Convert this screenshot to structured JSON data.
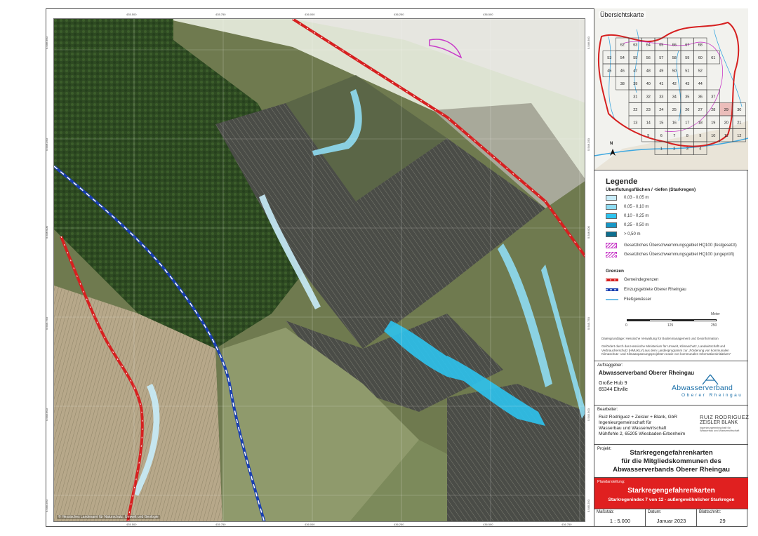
{
  "map": {
    "attribution": "© Hessisches Landesamt für Naturschutz, Umwelt und Geologie",
    "x_ticks": [
      "435.500",
      "435.750",
      "436.000",
      "436.250",
      "436.500",
      "436.750"
    ],
    "y_ticks": [
      "5.546.500",
      "5.546.250",
      "5.546.000",
      "5.545.750",
      "5.545.500",
      "5.545.250"
    ],
    "y_ticks_right": [
      "5.546.500",
      "5.546.250",
      "5.546.000",
      "5.545.750",
      "5.545.500",
      "5.545.250"
    ]
  },
  "overview": {
    "title": "Übersichtskarte",
    "north": "N",
    "tiles": [
      {
        "n": "62"
      },
      {
        "n": "63"
      },
      {
        "n": "64"
      },
      {
        "n": "65"
      },
      {
        "n": "66"
      },
      {
        "n": "67"
      },
      {
        "n": "68"
      },
      {
        "n": "53"
      },
      {
        "n": "54"
      },
      {
        "n": "55"
      },
      {
        "n": "56"
      },
      {
        "n": "57"
      },
      {
        "n": "58"
      },
      {
        "n": "59"
      },
      {
        "n": "60"
      },
      {
        "n": "61"
      },
      {
        "n": "45"
      },
      {
        "n": "46"
      },
      {
        "n": "47"
      },
      {
        "n": "48"
      },
      {
        "n": "49"
      },
      {
        "n": "50"
      },
      {
        "n": "51"
      },
      {
        "n": "52"
      },
      {
        "n": "38"
      },
      {
        "n": "39"
      },
      {
        "n": "40"
      },
      {
        "n": "41"
      },
      {
        "n": "42"
      },
      {
        "n": "43"
      },
      {
        "n": "44"
      },
      {
        "n": "31"
      },
      {
        "n": "32"
      },
      {
        "n": "33"
      },
      {
        "n": "34"
      },
      {
        "n": "35"
      },
      {
        "n": "36"
      },
      {
        "n": "37"
      },
      {
        "n": "22"
      },
      {
        "n": "23"
      },
      {
        "n": "24"
      },
      {
        "n": "25"
      },
      {
        "n": "26"
      },
      {
        "n": "27"
      },
      {
        "n": "28"
      },
      {
        "n": "29"
      },
      {
        "n": "30"
      },
      {
        "n": "13"
      },
      {
        "n": "14"
      },
      {
        "n": "15"
      },
      {
        "n": "16"
      },
      {
        "n": "17"
      },
      {
        "n": "18"
      },
      {
        "n": "19"
      },
      {
        "n": "20"
      },
      {
        "n": "21"
      },
      {
        "n": "5"
      },
      {
        "n": "6"
      },
      {
        "n": "7"
      },
      {
        "n": "8"
      },
      {
        "n": "9"
      },
      {
        "n": "10"
      },
      {
        "n": "11"
      },
      {
        "n": "12"
      },
      {
        "n": "1"
      },
      {
        "n": "2"
      },
      {
        "n": "3"
      },
      {
        "n": "4"
      }
    ]
  },
  "legend": {
    "title": "Legende",
    "flood_title": "Überflutungsflächen / -tiefen (Starkregen)",
    "flood_classes": [
      {
        "label": "0,03 - 0,05 m",
        "color": "#c8ecf9"
      },
      {
        "label": "0,05 - 0,10 m",
        "color": "#8fdcf2"
      },
      {
        "label": "0,10 - 0,25 m",
        "color": "#2ec3ee"
      },
      {
        "label": "0,25 - 0,50 m",
        "color": "#1797c6"
      },
      {
        "label": "> 0,50 m",
        "color": "#0d6f8f"
      }
    ],
    "hq_fixed": "Gesetzliches Überschwemmungsgebiet HQ100 (festgesetzt)",
    "hq_unchecked": "Gesetzliches Überschwemmungsgebiet HQ100 (ungeprüft)",
    "borders_title": "Grenzen",
    "municipal": "Gemeindegrenzen",
    "catchment": "Einzugsgebiete Oberer Rheingau",
    "rivers": "Fließgewässer",
    "scale_unit": "Meter",
    "scale_labels": [
      "0",
      "125",
      "250"
    ],
    "data_basis": "Datengrundlage: Hessische Verwaltung für Bodenmanagement und Geoinformation",
    "funding": "Gefördert durch das Hessische Ministerium für Umwelt, Klimaschutz, Landwirtschaft und Verbraucherschutz (HMUKLV) aus dem Landesprogramm zur „Förderung von kommunalen Klimaschutz- und Klimaanpassungsprojekten sowie von kommunalen Informationsinitiativen“"
  },
  "client": {
    "label": "Auftraggeber:",
    "name": "Abwasserverband Oberer Rheingau",
    "street": "Große Hub 9",
    "city": "65344 Eltville",
    "logo_main": "Abwasserverband",
    "logo_sub": "Oberer Rheingau"
  },
  "contractor": {
    "label": "Bearbeiter:",
    "lines": [
      "Ruiz Rodriguez + Zeisler + Blank, GbR",
      "Ingenieurgemeinschaft für",
      "Wasserbau und Wasserwirtschaft",
      "Mühlfohle 2, 65205 Wiesbaden-Erbenheim"
    ],
    "logo_line1": "RUIZ RODRIGUEZ",
    "logo_line2": "ZEISLER",
    "logo_line2b": "BLANK",
    "logo_sub1": "Ingenieurgemeinschaft für",
    "logo_sub2": "Wasserbau und Wasserwirtschaft"
  },
  "project": {
    "label": "Projekt:",
    "line1": "Starkregengefahrenkarten",
    "line2": "für die Mitgliedskommunen des",
    "line3": "Abwasserverbands Oberer Rheingau"
  },
  "plan": {
    "label": "Plandarstellung:",
    "title": "Starkregengefahrenkarten",
    "subtitle": "Starkregenindex 7 von 12 - außergewöhnlicher Starkregen"
  },
  "footer": {
    "scale_label": "Maßstab:",
    "scale": "1 : 5.000",
    "date_label": "Datum:",
    "date": "Januar 2023",
    "sheet_label": "Blattschnitt:",
    "sheet": "29"
  },
  "colors": {
    "municipal_red": "#d62020",
    "catchment_blue": "#1a3fb0",
    "river_blue": "#3fa8e0",
    "hq_magenta": "#c83bc8",
    "plan_red": "#e02020"
  }
}
